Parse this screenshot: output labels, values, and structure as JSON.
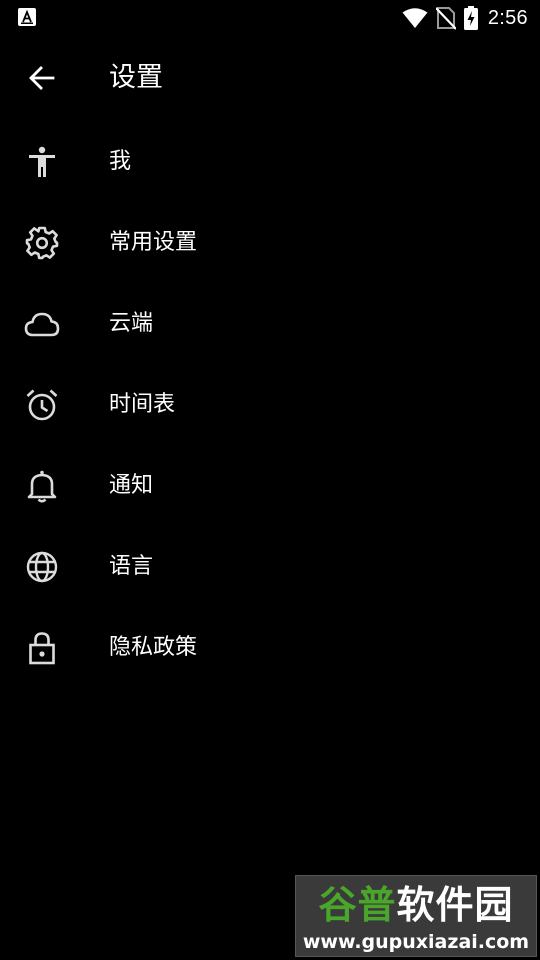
{
  "status_bar": {
    "time": "2:56",
    "icons": [
      "app-notification-icon",
      "wifi-icon",
      "no-sim-icon",
      "battery-charging-icon"
    ]
  },
  "app_bar": {
    "back_icon": "arrow-back-icon",
    "title": "设置"
  },
  "settings": {
    "items": [
      {
        "label": "我",
        "icon": "accessibility-person-icon"
      },
      {
        "label": "常用设置",
        "icon": "gear-icon"
      },
      {
        "label": "云端",
        "icon": "cloud-icon"
      },
      {
        "label": "时间表",
        "icon": "alarm-clock-icon"
      },
      {
        "label": "通知",
        "icon": "bell-icon"
      },
      {
        "label": "语言",
        "icon": "globe-icon"
      },
      {
        "label": "隐私政策",
        "icon": "lock-icon"
      }
    ]
  },
  "watermark": {
    "brand_part1": "谷普",
    "brand_part2": "软件园",
    "url": "www.gupuxiazai.com"
  },
  "colors": {
    "background": "#000000",
    "text": "#ffffff",
    "icon": "#dcdcdc",
    "watermark_green": "#4aa62b"
  }
}
